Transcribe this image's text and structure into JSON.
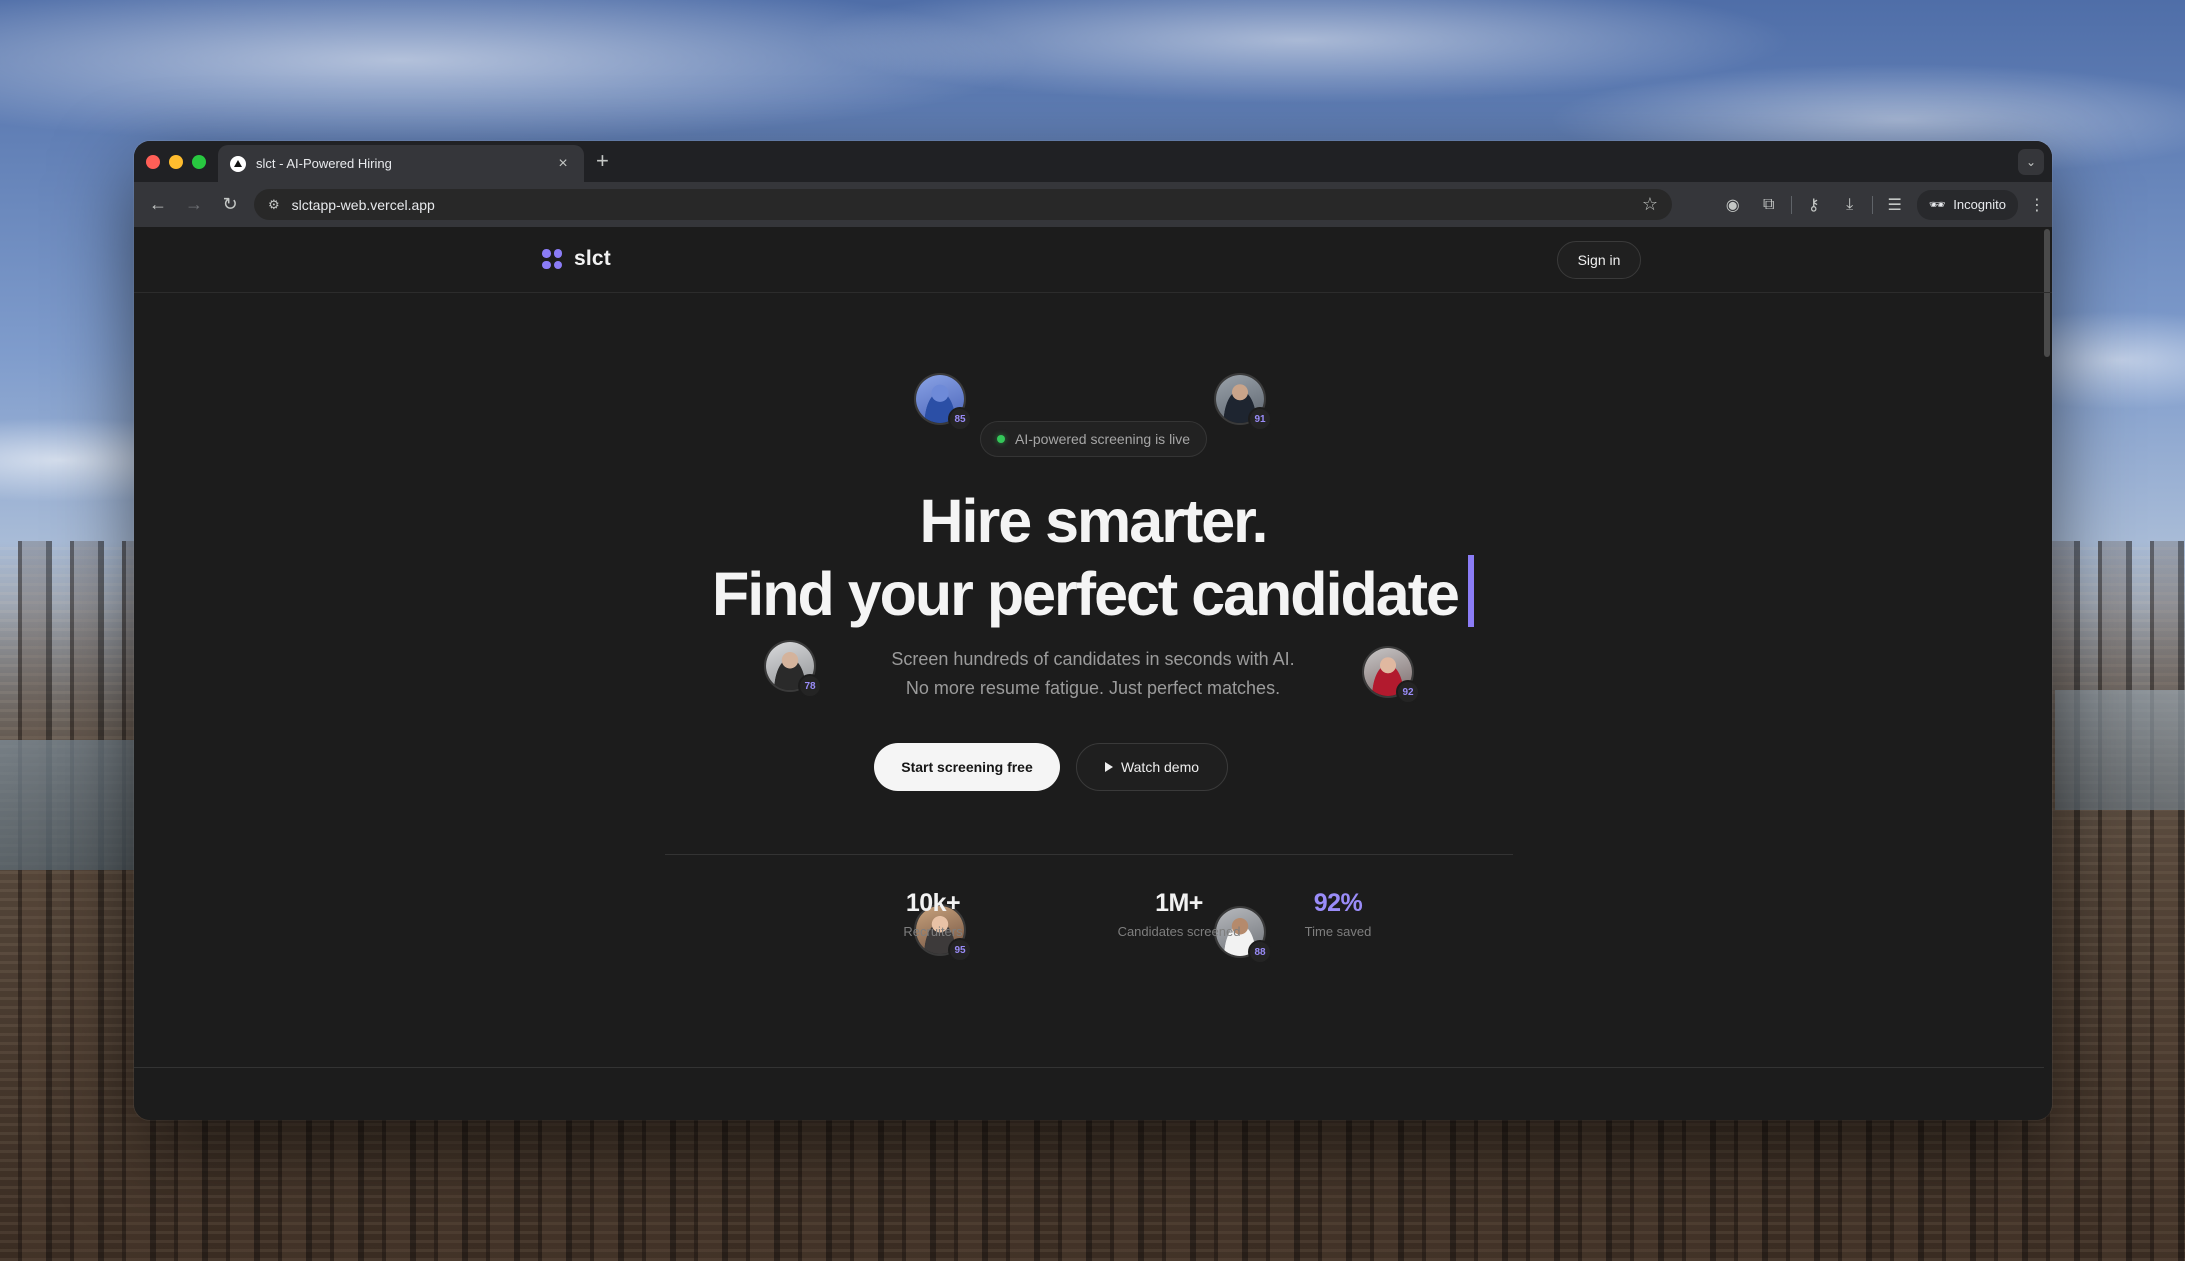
{
  "browser": {
    "tab_title": "slct - AI-Powered Hiring",
    "url": "slctapp-web.vercel.app",
    "incognito_label": "Incognito"
  },
  "site": {
    "logo_text": "slct",
    "signin_label": "Sign in",
    "badge_text": "AI-powered screening is live",
    "hero_line1": "Hire smarter.",
    "hero_line2": "Find your perfect candidate",
    "sub_line1": "Screen hundreds of candidates in seconds with AI.",
    "sub_line2": "No more resume fatigue. Just perfect matches.",
    "cta_primary": "Start screening free",
    "cta_secondary": "Watch demo"
  },
  "avatars": {
    "a": "85",
    "b": "91",
    "c": "78",
    "d": "92",
    "e": "95",
    "f": "88"
  },
  "stats": [
    {
      "value": "10k+",
      "label": "Recruiters"
    },
    {
      "value": "1M+",
      "label": "Candidates screened"
    },
    {
      "value": "92%",
      "label": "Time saved"
    }
  ],
  "colors": {
    "accent": "#8b7cf6",
    "live": "#34c759",
    "background": "#1c1c1c"
  }
}
